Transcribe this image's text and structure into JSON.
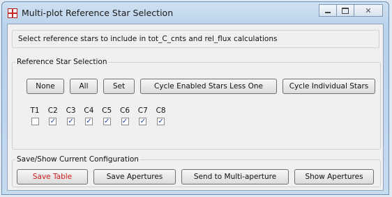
{
  "window": {
    "title": "Multi-plot Reference Star Selection",
    "icon": "plus-target-icon"
  },
  "info": {
    "text": "Select reference stars to include in tot_C_cnts and rel_flux calculations"
  },
  "reference_group": {
    "legend": "Reference Star Selection",
    "buttons": {
      "none": "None",
      "all": "All",
      "set": "Set",
      "cycle_enabled": "Cycle Enabled Stars Less One",
      "cycle_individual": "Cycle Individual Stars"
    },
    "stars": [
      {
        "label": "T1",
        "checked": false
      },
      {
        "label": "C2",
        "checked": true
      },
      {
        "label": "C3",
        "checked": true
      },
      {
        "label": "C4",
        "checked": true
      },
      {
        "label": "C5",
        "checked": true
      },
      {
        "label": "C6",
        "checked": true
      },
      {
        "label": "C7",
        "checked": true
      },
      {
        "label": "C8",
        "checked": true
      }
    ]
  },
  "config_group": {
    "legend": "Save/Show Current Configuration",
    "buttons": {
      "save_table": "Save Table",
      "save_apertures": "Save Apertures",
      "send_multi": "Send to Multi-aperture",
      "show_apertures": "Show Apertures"
    }
  },
  "colors": {
    "danger_text": "#d01b1b",
    "check": "#1f3f9a"
  }
}
